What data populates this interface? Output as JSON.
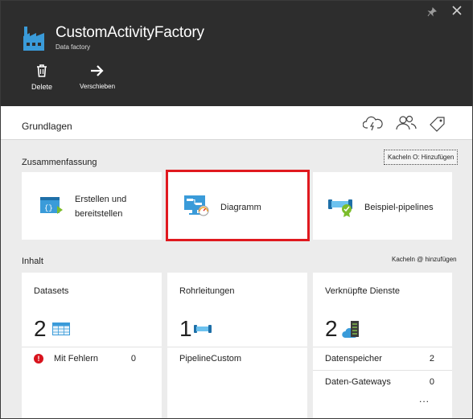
{
  "header": {
    "title": "CustomActivityFactory",
    "subtitle": "Data factory",
    "icons": {
      "pin": "pin-icon",
      "close": "close-icon",
      "factory": "data-factory-icon"
    },
    "commands": {
      "delete_label": "Delete",
      "move_label": "Verschieben"
    }
  },
  "essentials": {
    "label": "Grundlagen",
    "icons": [
      "cloud-lightning-icon",
      "users-icon",
      "tag-icon"
    ]
  },
  "summary": {
    "label": "Zusammenfassung",
    "add_tiles": "Kacheln O: Hinzufügen",
    "tiles": [
      {
        "label": "Erstellen und bereitstellen",
        "icon": "author-deploy-icon"
      },
      {
        "label": "Diagramm",
        "icon": "diagram-icon"
      },
      {
        "label": "Beispiel-pipelines",
        "icon": "sample-pipelines-icon"
      }
    ]
  },
  "content": {
    "label": "Inhalt",
    "add_tiles": "Kacheln @ hinzufügen",
    "datasets": {
      "title": "Datasets",
      "count": "2",
      "icon": "table-icon",
      "rows": [
        {
          "label": "Mit Fehlern",
          "value": "0",
          "icon": "error-icon"
        }
      ]
    },
    "pipelines": {
      "title": "Rohrleitungen",
      "count": "1",
      "icon": "pipeline-icon",
      "rows": [
        {
          "label": "PipelineCustom"
        }
      ]
    },
    "linked_services": {
      "title": "Verknüpfte Dienste",
      "count": "2",
      "icon": "linked-service-icon",
      "rows": [
        {
          "label": "Datenspeicher",
          "value": "2"
        },
        {
          "label": "Daten-Gateways",
          "value": "0"
        }
      ],
      "more": "..."
    }
  },
  "colors": {
    "header_bg": "#2d2d2d",
    "accent_blue": "#3a9bd9",
    "highlight": "#e0191f",
    "error": "#d8131d"
  }
}
